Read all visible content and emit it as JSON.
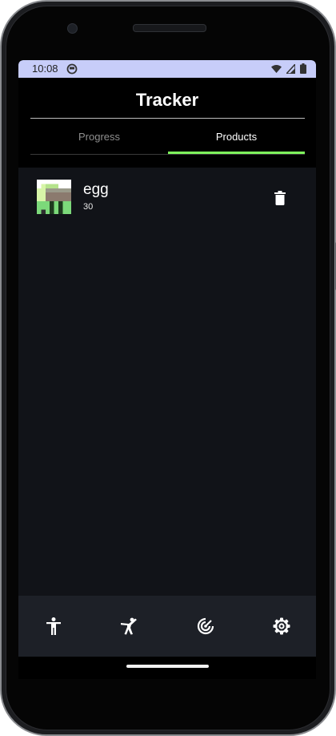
{
  "status_bar": {
    "time": "10:08",
    "icons": [
      "app-notification-icon",
      "wifi-icon",
      "signal-icon",
      "battery-icon"
    ]
  },
  "header": {
    "title": "Tracker"
  },
  "tabs": [
    {
      "label": "Progress",
      "selected": false
    },
    {
      "label": "Products",
      "selected": true
    }
  ],
  "products": [
    {
      "name": "egg",
      "quantity": "30",
      "thumbnail": "egg-pixel-thumbnail",
      "action_icon": "delete-icon"
    }
  ],
  "fab": {
    "icon": "plus-icon"
  },
  "bottom_nav": {
    "items": [
      {
        "icon": "person-standing-icon"
      },
      {
        "icon": "martial-arts-icon"
      },
      {
        "icon": "target-radar-icon"
      },
      {
        "icon": "settings-gear-icon"
      }
    ]
  },
  "colors": {
    "status_bar_bg": "#c7cdf9",
    "tab_indicator": "#7ff75c",
    "content_bg": "#111318",
    "fab_bg": "#3a4680",
    "bottom_nav_bg": "#1d2027"
  }
}
